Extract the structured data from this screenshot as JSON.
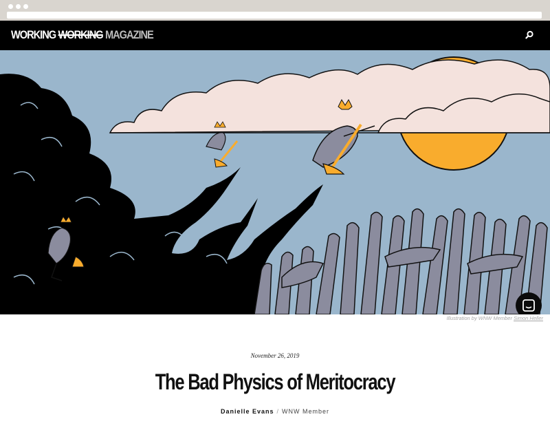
{
  "header": {
    "logo_part1": "WORKING",
    "logo_part2": "WORKING",
    "logo_part3": "MAGAZINE",
    "search_icon": "search-icon"
  },
  "hero": {
    "credit_prefix": "Illustration by WNW Member",
    "credit_artist": "Simon Heller",
    "colors": {
      "sky": "#9ab6cc",
      "sun": "#f9ac2d",
      "cloud": "#f4e2dd",
      "smoke": "#000000",
      "figure": "#8b8c9e",
      "crown": "#f9ac2d"
    }
  },
  "article": {
    "date": "November 26, 2019",
    "title": "The Bad Physics of Meritocracy",
    "author": "Danielle Evans",
    "separator": "/",
    "role": "WNW Member"
  },
  "chat": {
    "icon": "chat-icon"
  }
}
